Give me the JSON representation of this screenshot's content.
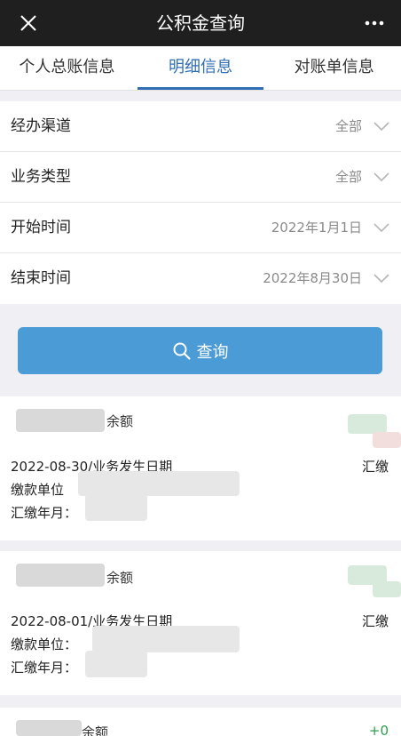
{
  "app": {
    "title": "公积金查询"
  },
  "tabs": [
    {
      "label": "个人总账信息"
    },
    {
      "label": "明细信息"
    },
    {
      "label": "对账单信息"
    }
  ],
  "filters": [
    {
      "label": "经办渠道",
      "value": "全部"
    },
    {
      "label": "业务类型",
      "value": "全部"
    },
    {
      "label": "开始时间",
      "value": "2022年1月1日"
    },
    {
      "label": "结束时间",
      "value": "2022年8月30日"
    }
  ],
  "query_button": {
    "label": "查询"
  },
  "records": [
    {
      "balance_label": "余额",
      "date_line": "2022-08-30/业务发生日期",
      "type": "汇缴",
      "unit_label": "缴款单位",
      "month_label": "汇缴年月："
    },
    {
      "balance_label": "余额",
      "date_line": "2022-08-01/业务发生日期",
      "type": "汇缴",
      "unit_label": "缴款单位：",
      "month_label": "汇缴年月："
    },
    {
      "balance_label": "余额",
      "amount": "+0"
    }
  ],
  "colors": {
    "titlebar": "#1f1f1f",
    "accent": "#2f6db5",
    "button": "#4a9bd6",
    "positive": "#2aa14b"
  }
}
